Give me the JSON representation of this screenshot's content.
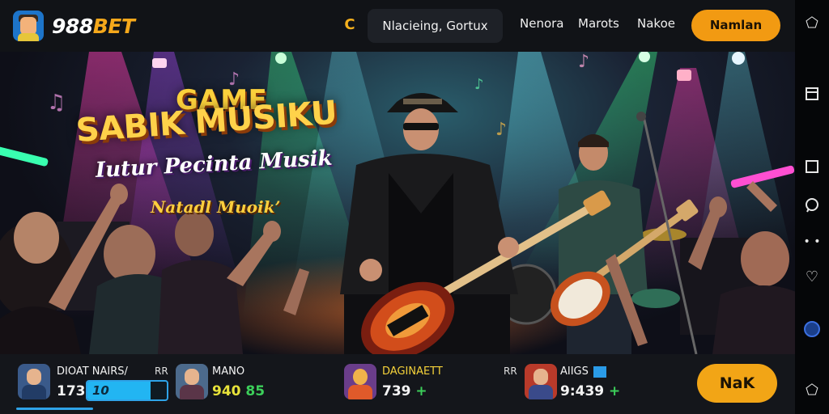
{
  "brand": {
    "name_white": "988",
    "name_accent": "BET"
  },
  "topbar": {
    "coin_glyph": "C",
    "search_text": "Nlacieing, Gortux",
    "nav": [
      "Nenora",
      "Marots",
      "Nakoe"
    ],
    "cta_label": "Namlan"
  },
  "hero": {
    "title_line1": "GAME",
    "title_line2": "SABIK MUSIKU",
    "title_line3": "Iutur Pecinta Musik",
    "title_line4": "Natadl Muoik’"
  },
  "bottombar": {
    "players": [
      {
        "name": "DIOAT NAIRS/",
        "value": "1733",
        "bar_label": "10",
        "progress_percent": 80,
        "tag": "RR"
      },
      {
        "name": "MANO",
        "value": "940",
        "plus": "85"
      },
      {
        "name": "DAGINAETT",
        "value": "739",
        "plus": "+",
        "tag": "RR"
      },
      {
        "name": "AIIGS",
        "value": "9:439",
        "plus": "+"
      }
    ],
    "join_label": "NaK"
  },
  "colors": {
    "accent": "#f29a12",
    "progress": "#22b5f2",
    "plus": "#3ccf5a"
  },
  "rail_icons": [
    "back-arrow-icon",
    "bookmark-icon",
    "square-icon",
    "chat-bubble-icon",
    "dots-icon",
    "heart-icon",
    "circle-button-icon",
    "share-arrow-icon"
  ]
}
